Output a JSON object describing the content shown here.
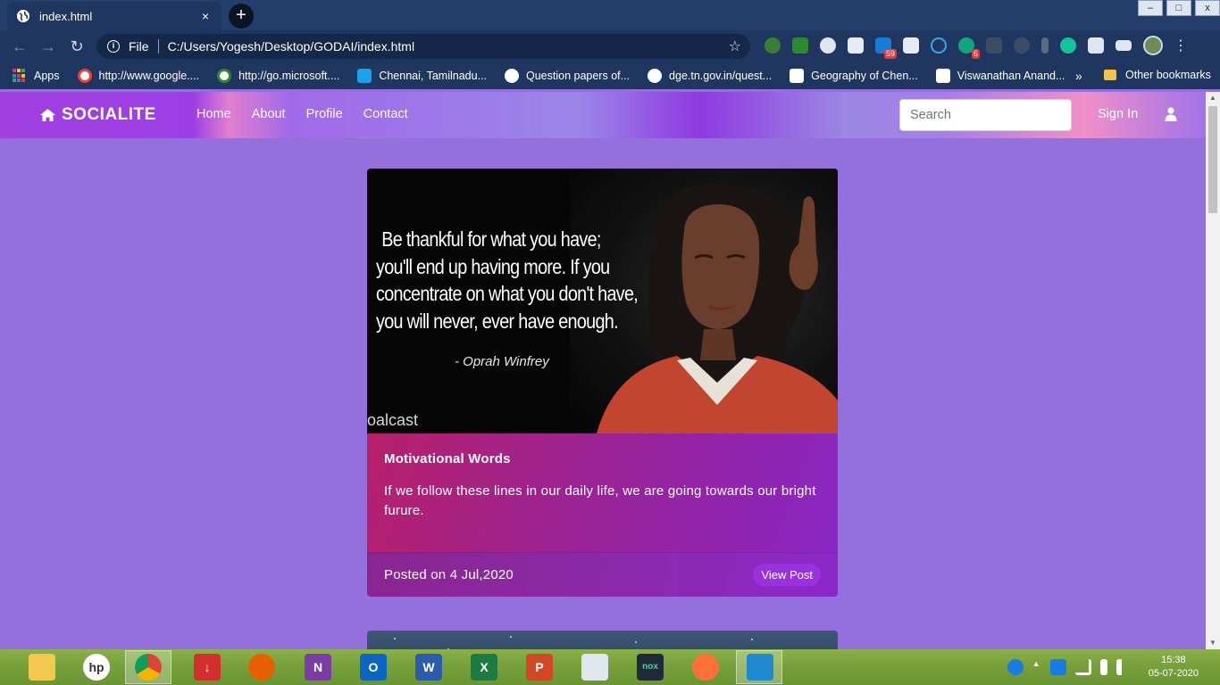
{
  "browser": {
    "tab_title": "index.html",
    "tab_close": "×",
    "new_tab": "+",
    "window_controls": [
      "–",
      "□",
      "x"
    ],
    "url_scheme": "File",
    "url": "C:/Users/Yogesh/Desktop/GODAI/index.html",
    "extension_badges": {
      "linkedin": "59",
      "grammar": "6"
    },
    "bookmarks": [
      {
        "label": "Apps",
        "icon": "apps-grid-icon"
      },
      {
        "label": "http://www.google....",
        "icon": "google-icon"
      },
      {
        "label": "http://go.microsoft....",
        "icon": "xbox-icon"
      },
      {
        "label": "Chennai, Tamilnadu...",
        "icon": "m-icon"
      },
      {
        "label": "Question papers of...",
        "icon": "globe-icon"
      },
      {
        "label": "dge.tn.gov.in/quest...",
        "icon": "globe-icon"
      },
      {
        "label": "Geography of Chen...",
        "icon": "wikipedia-icon"
      },
      {
        "label": "Viswanathan Anand...",
        "icon": "wikipedia-icon"
      }
    ],
    "bookmarks_more": "»",
    "other_bookmarks": "Other bookmarks"
  },
  "site": {
    "brand": "SOCIALITE",
    "nav": [
      "Home",
      "About",
      "Profile",
      "Contact"
    ],
    "search_placeholder": "Search",
    "signin": "Sign In"
  },
  "post": {
    "image_quote_lines": [
      "Be thankful for what you have;",
      "you'll end up having more. If you",
      "concentrate on what you don't have,",
      "you will never, ever have enough."
    ],
    "image_quote_author": "- Oprah Winfrey",
    "image_watermark": "oalcast",
    "title": "Motivational Words",
    "text": "If we follow these lines in our daily life, we are going towards our bright furure.",
    "posted": "Posted on 4 Jul,2020",
    "view_button": "View Post"
  },
  "taskbar": {
    "time": "15:38",
    "date": "05-07-2020"
  },
  "colors": {
    "page_bg": "#9370DB",
    "chrome_frame": "#233e6b",
    "card_gradient_start": "#b8206a",
    "card_gradient_end": "#8a26c4"
  }
}
